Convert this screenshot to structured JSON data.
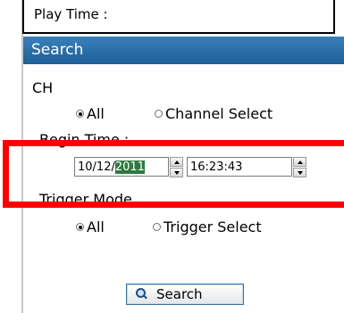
{
  "playtime": {
    "label": "Play Time :"
  },
  "search": {
    "header": "Search"
  },
  "ch": {
    "label": "CH",
    "options": [
      {
        "label": "All",
        "checked": true
      },
      {
        "label": "Channel Select",
        "checked": false
      }
    ]
  },
  "begin_time": {
    "label": "Begin Time :",
    "date_prefix": "10/12/",
    "date_selected": "2011",
    "time": "16:23:43"
  },
  "trigger_mode": {
    "label": "Trigger Mode",
    "options": [
      {
        "label": "All",
        "checked": true
      },
      {
        "label": "Trigger Select",
        "checked": false
      }
    ]
  },
  "button": {
    "label": "Search",
    "icon": "search-icon"
  },
  "colors": {
    "header_bg": "#2b6fa8",
    "highlight": "#ff0000",
    "selection": "#2f7a3e"
  }
}
